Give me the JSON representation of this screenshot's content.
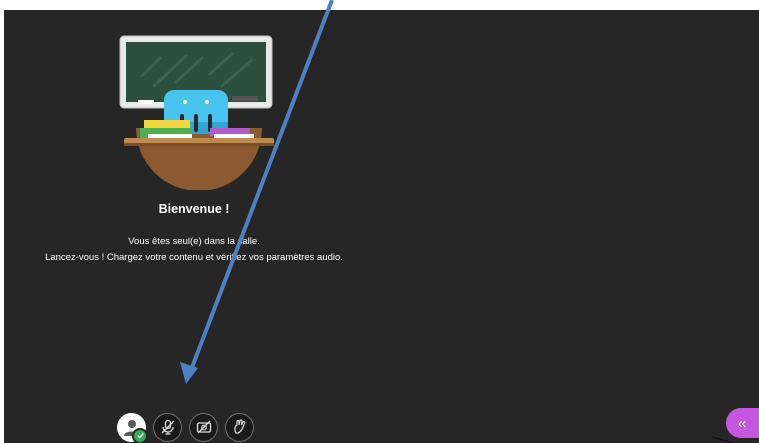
{
  "welcome": {
    "title": "Bienvenue !",
    "line1": "Vous êtes seul(e) dans la salle.",
    "line2": "Lancez-vous ! Chargez votre contenu et vérifiez vos paramètres audio."
  },
  "toolbar": {
    "buttons": [
      {
        "icon": "avatar-icon"
      },
      {
        "icon": "microphone-muted-icon"
      },
      {
        "icon": "camera-off-icon"
      },
      {
        "icon": "raise-hand-icon"
      }
    ]
  },
  "panel_toggle": {
    "glyph": "«"
  },
  "colors": {
    "background": "#262626",
    "accent": "#c556e0",
    "status": "#2eae55",
    "annotation_arrow": "#4f7fc4"
  }
}
